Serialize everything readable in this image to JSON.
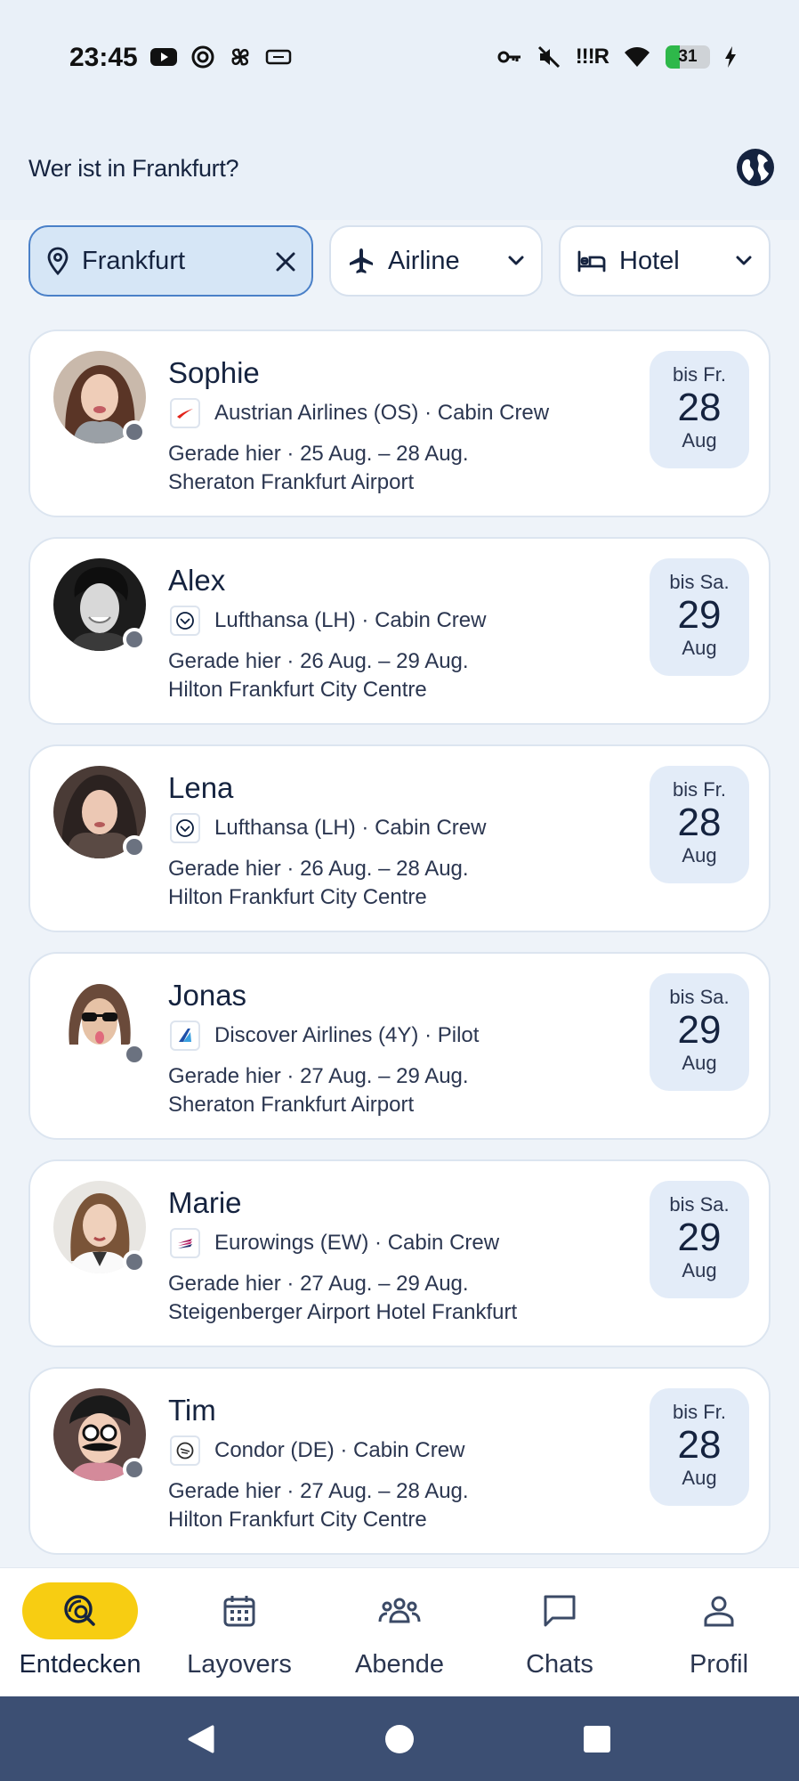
{
  "status_bar": {
    "time": "23:45",
    "network_label": "!!!R",
    "battery_percent": "31",
    "battery_level": 0.31,
    "left_icons": [
      "youtube-icon",
      "threads-icon",
      "pinwheel-icon",
      "vpn-chip-icon"
    ],
    "right_icons": [
      "key-icon",
      "mute-icon",
      "signal-icon",
      "wifi-icon",
      "battery-icon",
      "charging-icon"
    ]
  },
  "header": {
    "title": "Wer ist in Frankfurt?",
    "globe_icon": "globe-icon"
  },
  "filters": {
    "location": {
      "label": "Frankfurt",
      "icon": "location-pin-icon",
      "clear_icon": "close-icon"
    },
    "airline": {
      "label": "Airline",
      "icon": "airplane-icon",
      "dropdown_icon": "chevron-down-icon"
    },
    "hotel": {
      "label": "Hotel",
      "icon": "bed-icon",
      "dropdown_icon": "chevron-down-icon"
    }
  },
  "crew": [
    {
      "name": "Sophie",
      "airline": "Austrian Airlines (OS) · Cabin Crew",
      "dates": "Gerade hier · 25 Aug. – 28 Aug.",
      "hotel": "Sheraton Frankfurt Airport",
      "until_day": "bis Fr.",
      "until_num": "28",
      "until_mon": "Aug",
      "logo": "austrian-logo-icon"
    },
    {
      "name": "Alex",
      "airline": "Lufthansa (LH) · Cabin Crew",
      "dates": "Gerade hier · 26 Aug. – 29 Aug.",
      "hotel": "Hilton Frankfurt City Centre",
      "until_day": "bis Sa.",
      "until_num": "29",
      "until_mon": "Aug",
      "logo": "lufthansa-logo-icon"
    },
    {
      "name": "Lena",
      "airline": "Lufthansa (LH) · Cabin Crew",
      "dates": "Gerade hier · 26 Aug. – 28 Aug.",
      "hotel": "Hilton Frankfurt City Centre",
      "until_day": "bis Fr.",
      "until_num": "28",
      "until_mon": "Aug",
      "logo": "lufthansa-logo-icon"
    },
    {
      "name": "Jonas",
      "airline": "Discover Airlines (4Y) · Pilot",
      "dates": "Gerade hier · 27 Aug. – 29 Aug.",
      "hotel": "Sheraton Frankfurt Airport",
      "until_day": "bis Sa.",
      "until_num": "29",
      "until_mon": "Aug",
      "logo": "discover-logo-icon"
    },
    {
      "name": "Marie",
      "airline": "Eurowings (EW) · Cabin Crew",
      "dates": "Gerade hier · 27 Aug. – 29 Aug.",
      "hotel": "Steigenberger Airport Hotel Frankfurt",
      "until_day": "bis Sa.",
      "until_num": "29",
      "until_mon": "Aug",
      "logo": "eurowings-logo-icon"
    },
    {
      "name": "Tim",
      "airline": "Condor (DE) · Cabin Crew",
      "dates": "Gerade hier · 27 Aug. – 28 Aug.",
      "hotel": "Hilton Frankfurt City Centre",
      "until_day": "bis Fr.",
      "until_num": "28",
      "until_mon": "Aug",
      "logo": "condor-logo-icon"
    }
  ],
  "bottom_nav": [
    {
      "label": "Entdecken",
      "icon": "discover-search-icon",
      "active": true
    },
    {
      "label": "Layovers",
      "icon": "calendar-icon",
      "active": false
    },
    {
      "label": "Abende",
      "icon": "group-icon",
      "active": false
    },
    {
      "label": "Chats",
      "icon": "chat-icon",
      "active": false
    },
    {
      "label": "Profil",
      "icon": "person-icon",
      "active": false
    }
  ],
  "colors": {
    "accent": "#f7cd12",
    "primary_text": "#15233f",
    "chip_selected_bg": "#d6e6f6",
    "chip_selected_border": "#4a80c8",
    "date_box_bg": "#e3ecf8",
    "system_nav_bg": "#3c4f73"
  }
}
